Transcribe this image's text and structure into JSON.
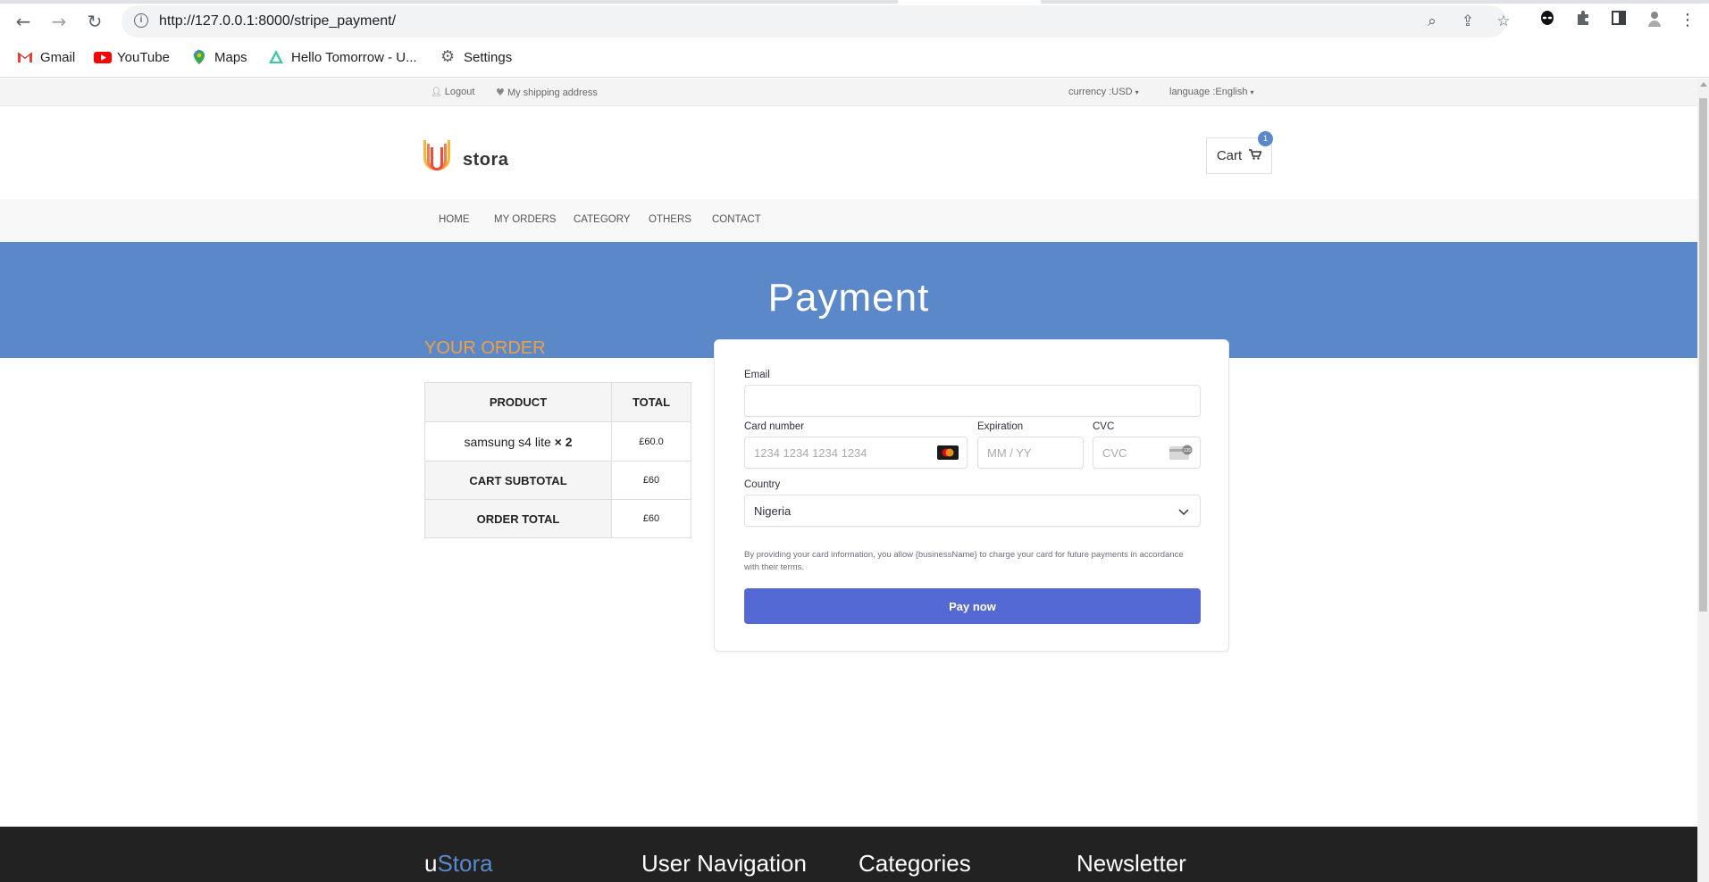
{
  "browser": {
    "url": "http://127.0.0.1:8000/stripe_payment/",
    "bookmarks": [
      {
        "label": "Gmail",
        "icon": "gmail-icon"
      },
      {
        "label": "YouTube",
        "icon": "youtube-icon"
      },
      {
        "label": "Maps",
        "icon": "maps-icon"
      },
      {
        "label": "Hello Tomorrow - U...",
        "icon": "hello-tomorrow-icon"
      },
      {
        "label": "Settings",
        "icon": "gear-icon"
      }
    ]
  },
  "topbar": {
    "logout": "Logout",
    "shipping": "My shipping address",
    "currency": "currency :USD",
    "language": "language :English"
  },
  "header": {
    "logo_text": "stora",
    "cart_label": "Cart",
    "cart_count": "1"
  },
  "menu": [
    "HOME",
    "MY ORDERS",
    "CATEGORY",
    "OTHERS",
    "CONTACT"
  ],
  "banner": {
    "title": "Payment"
  },
  "order": {
    "title": "YOUR ORDER",
    "headers": [
      "PRODUCT",
      "TOTAL"
    ],
    "item_name": "samsung s4 lite",
    "item_qty": "× 2",
    "item_price": "£60.0",
    "subtotal_label": "CART SUBTOTAL",
    "subtotal": "£60",
    "total_label": "ORDER TOTAL",
    "total": "£60"
  },
  "payment": {
    "email_label": "Email",
    "email_value": "",
    "card_label": "Card number",
    "card_placeholder": "1234 1234 1234 1234",
    "exp_label": "Expiration",
    "exp_placeholder": "MM / YY",
    "cvc_label": "CVC",
    "cvc_placeholder": "CVC",
    "country_label": "Country",
    "country_value": "Nigeria",
    "consent": "By providing your card information, you allow {businessName} to charge your card for future payments in accordance with their terms.",
    "pay_button": "Pay now",
    "accent": "#5469d4"
  },
  "footer": {
    "brand_u": "u",
    "brand_rest": "Stora",
    "user_nav": "User Navigation",
    "categories": "Categories",
    "newsletter": "Newsletter"
  },
  "colors": {
    "banner": "#5b88c9",
    "order_title": "#f0a041",
    "footer": "#222222",
    "brand_link": "#5a88ca"
  }
}
